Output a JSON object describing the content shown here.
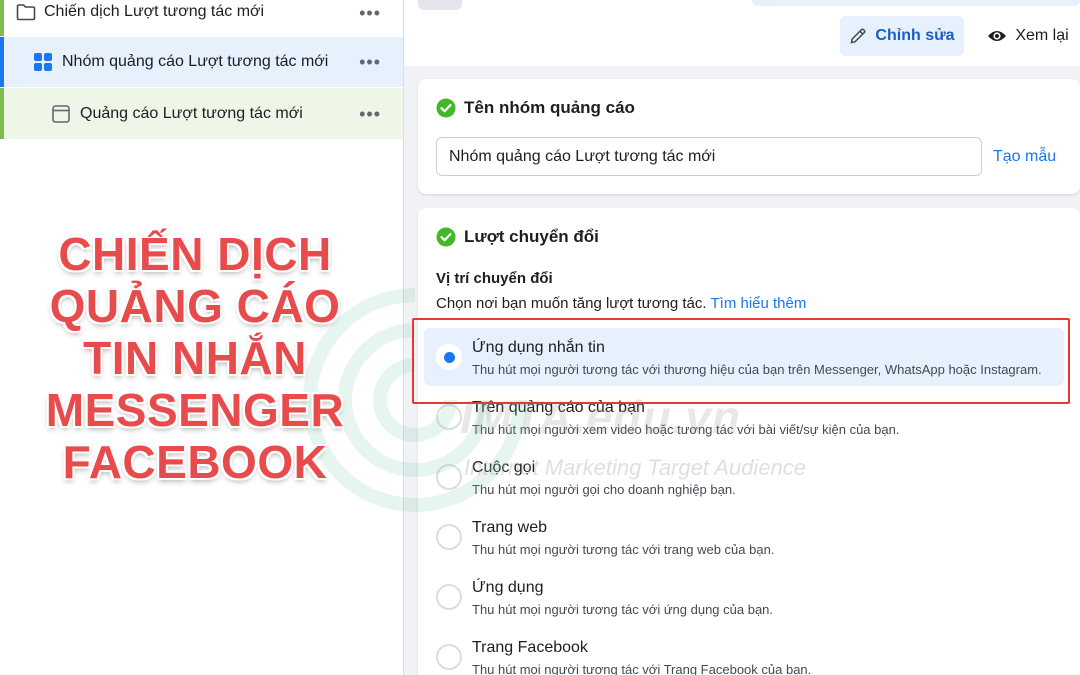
{
  "sidebar": {
    "campaign": {
      "label": "Chiến dịch Lượt tương tác mới",
      "more": "•••"
    },
    "adset": {
      "label": "Nhóm quảng cáo Lượt tương tác mới",
      "more": "•••"
    },
    "ad": {
      "label": "Quảng cáo Lượt tương tác mới",
      "more": "•••"
    }
  },
  "overlay": {
    "lines": [
      "CHIẾN DỊCH",
      "QUẢNG CÁO",
      "TIN NHẮN",
      "MESSENGER",
      "FACEBOOK"
    ],
    "color": "#e84b4b"
  },
  "watermark": {
    "text": "IMTA.edu.vn",
    "subtext": "Internet Marketing Target Audience"
  },
  "toolbar": {
    "edit_label": "Chỉnh sửa",
    "review_label": "Xem lại"
  },
  "adset_name_card": {
    "title": "Tên nhóm quảng cáo",
    "input_value": "Nhóm quảng cáo Lượt tương tác mới",
    "template_link": "Tạo mẫu"
  },
  "conversion_card": {
    "title": "Lượt chuyển đổi",
    "location_label": "Vị trí chuyển đổi",
    "description": "Chọn nơi bạn muốn tăng lượt tương tác.",
    "learn_more": "Tìm hiểu thêm",
    "options": [
      {
        "title": "Ứng dụng nhắn tin",
        "desc": "Thu hút mọi người tương tác với thương hiệu của bạn trên Messenger, WhatsApp hoặc Instagram.",
        "selected": true
      },
      {
        "title": "Trên quảng cáo của bạn",
        "desc": "Thu hút mọi người xem video hoặc tương tác với bài viết/sự kiện của bạn.",
        "selected": false
      },
      {
        "title": "Cuộc gọi",
        "desc": "Thu hút mọi người gọi cho doanh nghiệp bạn.",
        "selected": false
      },
      {
        "title": "Trang web",
        "desc": "Thu hút mọi người tương tác với trang web của bạn.",
        "selected": false
      },
      {
        "title": "Ứng dụng",
        "desc": "Thu hút mọi người tương tác với ứng dụng của bạn.",
        "selected": false
      },
      {
        "title": "Trang Facebook",
        "desc": "Thu hút mọi người tương tác với Trang Facebook của bạn.",
        "selected": false
      }
    ]
  },
  "colors": {
    "accent": "#1877f2",
    "selected_bg": "#e7f0fd",
    "success": "#42b72a",
    "highlight_border": "#e53935"
  },
  "icons": {
    "campaign": "folder-icon",
    "adset": "grid-icon",
    "ad": "ad-frame-icon",
    "edit": "pencil-icon",
    "review": "eye-icon",
    "complete": "check-circle-icon"
  }
}
